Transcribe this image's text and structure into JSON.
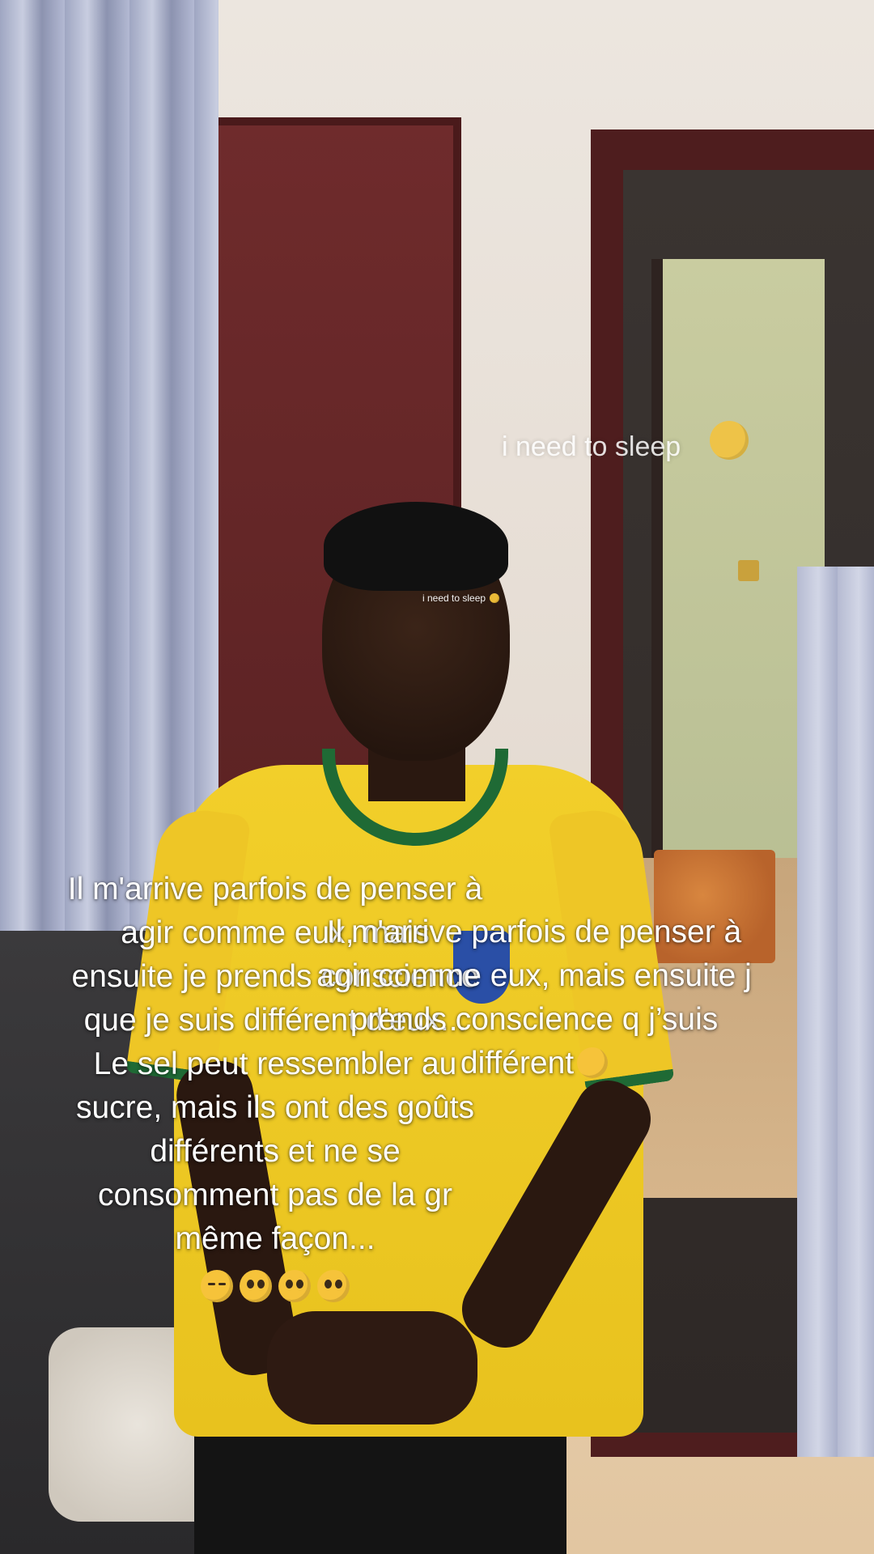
{
  "stickers": {
    "large_text": "i need to sleep",
    "large_emoji": "slightly-smiling-tongue-emoji",
    "small_text": "i need to sleep",
    "small_emoji": "slightly-smiling-tongue-emoji"
  },
  "caption_left": {
    "lines": [
      "Il m'arrive parfois de penser à",
      "agir comme eux, mais",
      "ensuite je prends conscience",
      "que je suis différent d'eux...",
      "Le sel peut ressembler au",
      "sucre, mais ils ont des goûts",
      "différents et ne se",
      "consomment pas de la gr",
      "même façon..."
    ],
    "emojis": [
      "pensive-face-emoji",
      "pleading-face-emoji",
      "pleading-face-emoji",
      "pleading-face-emoji"
    ]
  },
  "caption_right": {
    "lines": [
      "Il m'arrive parfois de penser à",
      "agir comme eux, mais ensuite j",
      "prends conscience q j’suis",
      "différent"
    ],
    "trailing_emoji": "pleading-face-emoji"
  },
  "colors": {
    "jersey_yellow": "#f2cf2a",
    "jersey_green": "#1f6a35",
    "door_maroon": "#6f2b2c",
    "caption_text": "#ffffff"
  }
}
